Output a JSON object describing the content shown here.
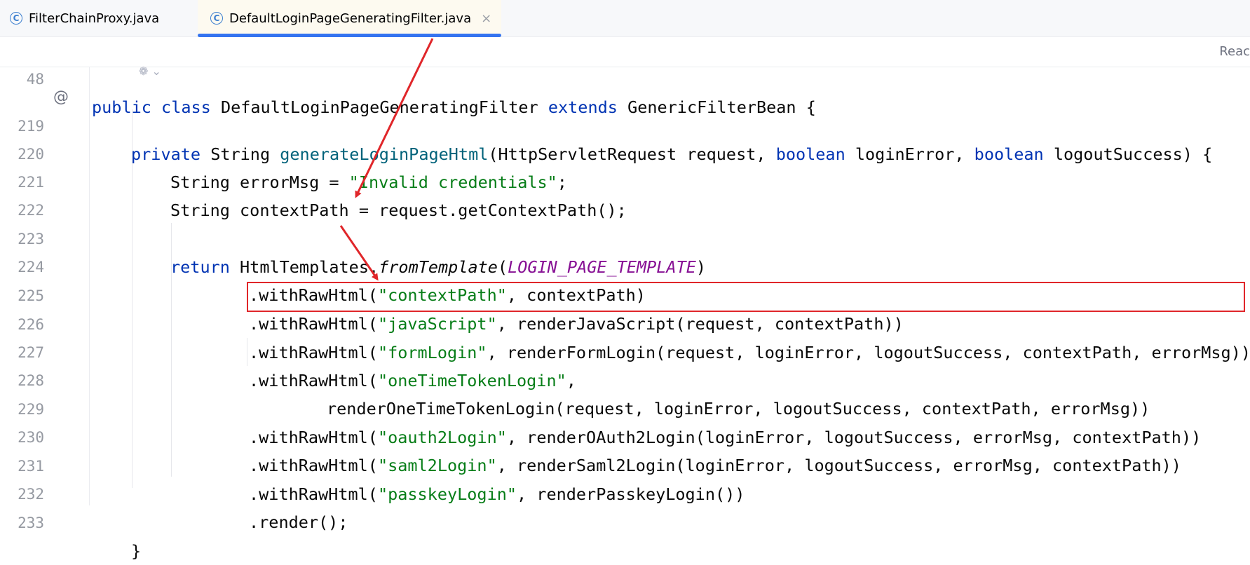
{
  "tabs": [
    {
      "label": "FilterChainProxy.java",
      "icon": "class-icon",
      "active": false
    },
    {
      "label": "DefaultLoginPageGeneratingFilter.java",
      "icon": "class-icon",
      "active": true
    }
  ],
  "tab_close_glyph": "×",
  "reader_mode_label": "Reac",
  "sticky_line": {
    "number": "48"
  },
  "lines": [
    {
      "number": "219"
    },
    {
      "number": "220"
    },
    {
      "number": "221"
    },
    {
      "number": "222"
    },
    {
      "number": "223"
    },
    {
      "number": "224"
    },
    {
      "number": "225"
    },
    {
      "number": "226"
    },
    {
      "number": "227"
    },
    {
      "number": "228"
    },
    {
      "number": "229"
    },
    {
      "number": "230"
    },
    {
      "number": "231"
    },
    {
      "number": "232"
    },
    {
      "number": "233"
    }
  ],
  "code": {
    "l48": {
      "k1": "public",
      "k2": "class",
      "name": "DefaultLoginPageGeneratingFilter",
      "k3": "extends",
      "base": "GenericFilterBean {"
    },
    "l219": {
      "k1": "private",
      "t1": "String",
      "m": "generateLoginPageHtml",
      "p1": "(HttpServletRequest request, ",
      "k2": "boolean",
      "p2": " loginError, ",
      "k3": "boolean",
      "p3": " logoutSuccess) {"
    },
    "l220": {
      "a": "String errorMsg = ",
      "s": "\"Invalid credentials\"",
      "b": ";"
    },
    "l221": {
      "a": "String contextPath = request.getContextPath();"
    },
    "l223": {
      "k": "return",
      "a": " HtmlTemplates.",
      "m": "fromTemplate",
      "b": "(",
      "c": "LOGIN_PAGE_TEMPLATE",
      "d": ")"
    },
    "l224": {
      "a": ".withRawHtml(",
      "s": "\"contextPath\"",
      "b": ", contextPath)"
    },
    "l225": {
      "a": ".withRawHtml(",
      "s": "\"javaScript\"",
      "b": ", renderJavaScript(request, contextPath))"
    },
    "l226": {
      "a": ".withRawHtml(",
      "s": "\"formLogin\"",
      "b": ", renderFormLogin(request, loginError, logoutSuccess, contextPath, errorMsg))"
    },
    "l227": {
      "a": ".withRawHtml(",
      "s": "\"oneTimeTokenLogin\"",
      "b": ","
    },
    "l228": {
      "a": "renderOneTimeTokenLogin(request, loginError, logoutSuccess, contextPath, errorMsg))"
    },
    "l229": {
      "a": ".withRawHtml(",
      "s": "\"oauth2Login\"",
      "b": ", renderOAuth2Login(loginError, logoutSuccess, errorMsg, contextPath))"
    },
    "l230": {
      "a": ".withRawHtml(",
      "s": "\"saml2Login\"",
      "b": ", renderSaml2Login(loginError, logoutSuccess, errorMsg, contextPath))"
    },
    "l231": {
      "a": ".withRawHtml(",
      "s": "\"passkeyLogin\"",
      "b": ", renderPasskeyLogin())"
    },
    "l232": {
      "a": ".render();"
    },
    "l233": {
      "a": "}"
    }
  },
  "gutter_icons": {
    "override_marker": "@",
    "inlay_hint": "ai-assist-icon"
  },
  "colors": {
    "keyword": "#0033b3",
    "string": "#067d17",
    "method": "#00627a",
    "constant": "#871094",
    "annotation_red": "#e0262a",
    "tab_underline": "#3574f0"
  }
}
